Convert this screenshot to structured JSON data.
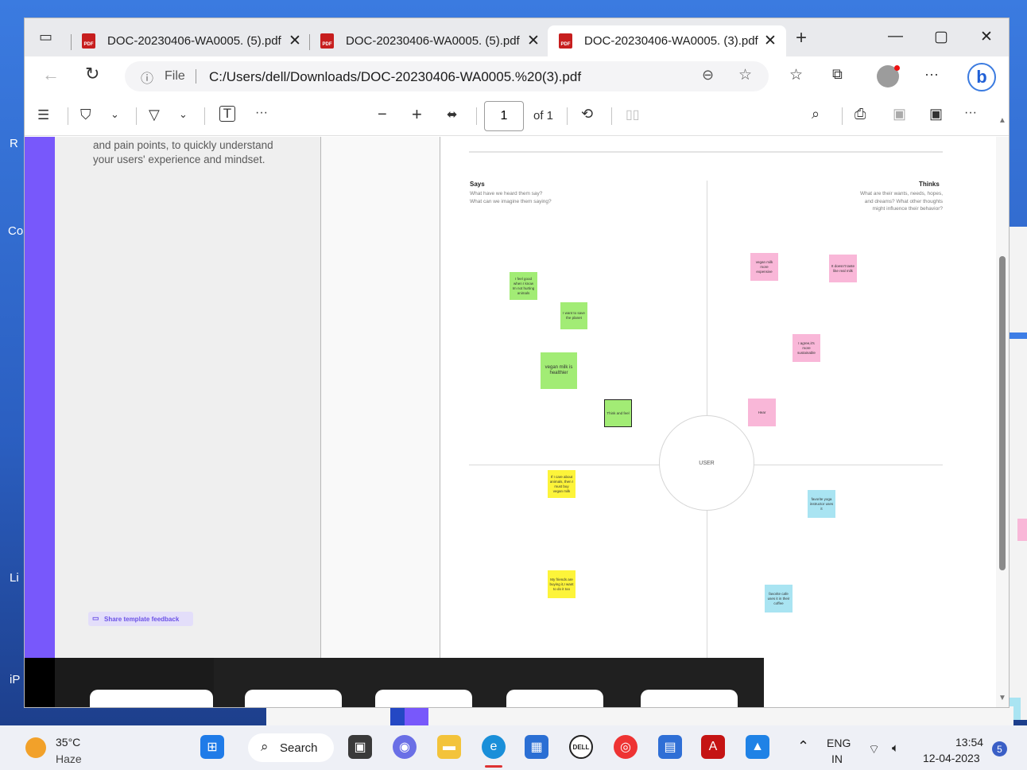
{
  "desktop": {
    "letters": [
      "R",
      "Co",
      "Li",
      "iP"
    ]
  },
  "tabs": [
    {
      "label": "DOC-20230406-WA0005. (5).pdf"
    },
    {
      "label": "DOC-20230406-WA0005. (5).pdf"
    },
    {
      "label": "DOC-20230406-WA0005. (3).pdf"
    }
  ],
  "address": {
    "file_label": "File",
    "url": "C:/Users/dell/Downloads/DOC-20230406-WA0005.%20(3).pdf"
  },
  "pdf_toolbar": {
    "page": "1",
    "of_label": "of 1"
  },
  "left_panel": {
    "text": "and pain points, to quickly understand your users' experience and mindset.",
    "feedback_label": "Share template feedback"
  },
  "map": {
    "center_label": "USER",
    "says": {
      "title": "Says",
      "sub1": "What have we heard them say?",
      "sub2": "What can we imagine them saying?"
    },
    "thinks": {
      "title": "Thinks",
      "sub1": "What are their wants, needs, hopes,",
      "sub2": "and dreams? What other thoughts",
      "sub3": "might influence their behavior?"
    },
    "notes": [
      "I feel good when I know Im not hurting animals",
      "I want to save the planet",
      "vegan milk is healthier",
      "Think and feel",
      "If I care about animals, then I must buy vegan milk",
      "My friends are buying it,I want to do it too",
      "vegan milk more expensive",
      "It doesn't taste like real milk",
      "I agree,it's more sustainable",
      "Hear",
      "favorite yoga instructor uses it",
      "favorite cafe uses it in their coffee"
    ]
  },
  "taskbar": {
    "weather_temp": "35°C",
    "weather_desc": "Haze",
    "search_label": "Search",
    "lang1": "ENG",
    "lang2": "IN",
    "time": "13:54",
    "date": "12-04-2023",
    "notif_count": "5"
  },
  "colors": {
    "purple": "#7858fb",
    "note_green": "#a2ec75",
    "note_yellow": "#fdf43a",
    "note_pink": "#f9b7d8",
    "note_blue": "#a9e4f2"
  }
}
